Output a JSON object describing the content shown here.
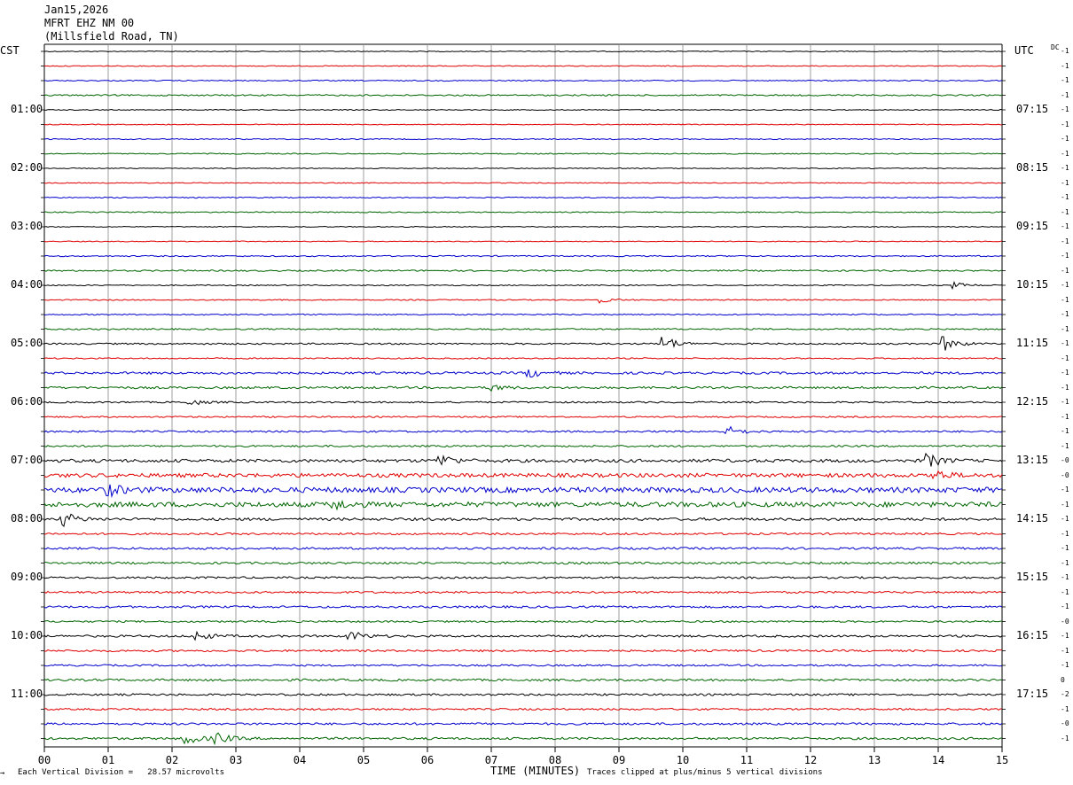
{
  "header": {
    "date": "Jan15,2026",
    "station": "MFRT EHZ NM 00",
    "location": "(Millsfield Road, TN)"
  },
  "left_tz": "CST",
  "right_tz": "UTC",
  "dc_label": "DC",
  "footer": {
    "scale_mark": "→",
    "division": "Each Vertical Division =   28.57 microvolts",
    "xlabel": "TIME (MINUTES)",
    "clip_note": "Traces clipped at plus/minus 5 vertical divisions"
  },
  "colors": [
    "#000000",
    "#e00000",
    "#0000cc",
    "#006600"
  ],
  "chart_data": {
    "type": "line",
    "title": "MFRT EHZ NM 00",
    "xlabel": "TIME (MINUTES)",
    "x_ticks": [
      "00",
      "01",
      "02",
      "03",
      "04",
      "05",
      "06",
      "07",
      "08",
      "09",
      "10",
      "11",
      "12",
      "13",
      "14",
      "15"
    ],
    "xlim": [
      0,
      15
    ],
    "n_traces": 48,
    "minutes_per_trace": 15,
    "left_labels": [
      {
        "trace": 4,
        "label": "01:00"
      },
      {
        "trace": 8,
        "label": "02:00"
      },
      {
        "trace": 12,
        "label": "03:00"
      },
      {
        "trace": 16,
        "label": "04:00"
      },
      {
        "trace": 20,
        "label": "05:00"
      },
      {
        "trace": 24,
        "label": "06:00"
      },
      {
        "trace": 28,
        "label": "07:00"
      },
      {
        "trace": 32,
        "label": "08:00"
      },
      {
        "trace": 36,
        "label": "09:00"
      },
      {
        "trace": 40,
        "label": "10:00"
      },
      {
        "trace": 44,
        "label": "11:00"
      }
    ],
    "right_labels": [
      {
        "trace": 4,
        "label": "07:15"
      },
      {
        "trace": 8,
        "label": "08:15"
      },
      {
        "trace": 12,
        "label": "09:15"
      },
      {
        "trace": 16,
        "label": "10:15"
      },
      {
        "trace": 20,
        "label": "11:15"
      },
      {
        "trace": 24,
        "label": "12:15"
      },
      {
        "trace": 28,
        "label": "13:15"
      },
      {
        "trace": 32,
        "label": "14:15"
      },
      {
        "trace": 36,
        "label": "15:15"
      },
      {
        "trace": 40,
        "label": "16:15"
      },
      {
        "trace": 44,
        "label": "17:15"
      }
    ],
    "dc_offsets": [
      "-1",
      "-1",
      "-1",
      "-1",
      "-1",
      "-1",
      "-1",
      "-1",
      "-1",
      "-1",
      "-1",
      "-1",
      "-1",
      "-1",
      "-1",
      "-1",
      "-1",
      "-1",
      "-1",
      "-1",
      "-1",
      "-1",
      "-1",
      "-1",
      "-1",
      "-1",
      "-1",
      "-1",
      "-0",
      "-0",
      "-1",
      "-1",
      "-1",
      "-1",
      "-1",
      "-1",
      "-1",
      "-1",
      "-1",
      "-0",
      "-1",
      "-1",
      "-1",
      "0",
      "-2",
      "-1",
      "-0",
      "-1"
    ],
    "trace_amplitude": [
      0.5,
      0.5,
      0.6,
      0.8,
      0.5,
      0.5,
      0.6,
      0.6,
      0.5,
      0.5,
      0.6,
      0.6,
      0.5,
      0.5,
      0.7,
      0.8,
      0.6,
      0.6,
      0.7,
      0.8,
      0.9,
      0.7,
      1.3,
      1.2,
      0.9,
      0.8,
      1.0,
      1.0,
      1.8,
      2.2,
      3.0,
      2.8,
      1.5,
      1.1,
      1.2,
      1.2,
      1.1,
      1.1,
      1.2,
      1.0,
      1.2,
      1.1,
      1.0,
      1.2,
      1.1,
      1.0,
      1.2,
      1.3
    ],
    "events": [
      {
        "trace": 16,
        "minute": 14.2,
        "amp": 4
      },
      {
        "trace": 17,
        "minute": 8.7,
        "amp": 3
      },
      {
        "trace": 20,
        "minute": 9.7,
        "amp": 9
      },
      {
        "trace": 20,
        "minute": 14.1,
        "amp": 8
      },
      {
        "trace": 22,
        "minute": 7.6,
        "amp": 5
      },
      {
        "trace": 23,
        "minute": 7.0,
        "amp": 4
      },
      {
        "trace": 24,
        "minute": 2.3,
        "amp": 3
      },
      {
        "trace": 26,
        "minute": 10.7,
        "amp": 6
      },
      {
        "trace": 28,
        "minute": 6.2,
        "amp": 7
      },
      {
        "trace": 28,
        "minute": 13.8,
        "amp": 9
      },
      {
        "trace": 29,
        "minute": 13.9,
        "amp": 7
      },
      {
        "trace": 30,
        "minute": 1.0,
        "amp": 6
      },
      {
        "trace": 31,
        "minute": 4.5,
        "amp": 6
      },
      {
        "trace": 32,
        "minute": 0.3,
        "amp": 8
      },
      {
        "trace": 40,
        "minute": 2.4,
        "amp": 5
      },
      {
        "trace": 40,
        "minute": 4.8,
        "amp": 6
      },
      {
        "trace": 47,
        "minute": 2.2,
        "amp": 8
      },
      {
        "trace": 47,
        "minute": 2.7,
        "amp": 6
      }
    ]
  }
}
